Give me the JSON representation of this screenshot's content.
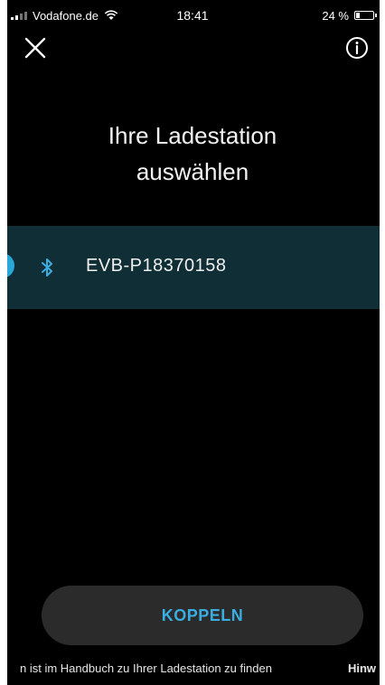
{
  "status_bar": {
    "carrier": "Vodafone.de",
    "time": "18:41",
    "battery_label": "24 %",
    "battery_level": 0.24
  },
  "header": {
    "title_line1": "Ihre Ladestation",
    "title_line2": "auswählen"
  },
  "devices": [
    {
      "name": "EVB-P18370158",
      "icon": "bluetooth-icon",
      "selected": true
    }
  ],
  "actions": {
    "pair_label": "KOPPELN"
  },
  "footer": {
    "hint_text": "n ist im Handbuch zu Ihrer Ladestation zu finden",
    "hint_link": "Hinw"
  },
  "colors": {
    "accent": "#3aaee0",
    "selected_row": "#0f2e35",
    "button_bg": "#2b2b2b"
  }
}
